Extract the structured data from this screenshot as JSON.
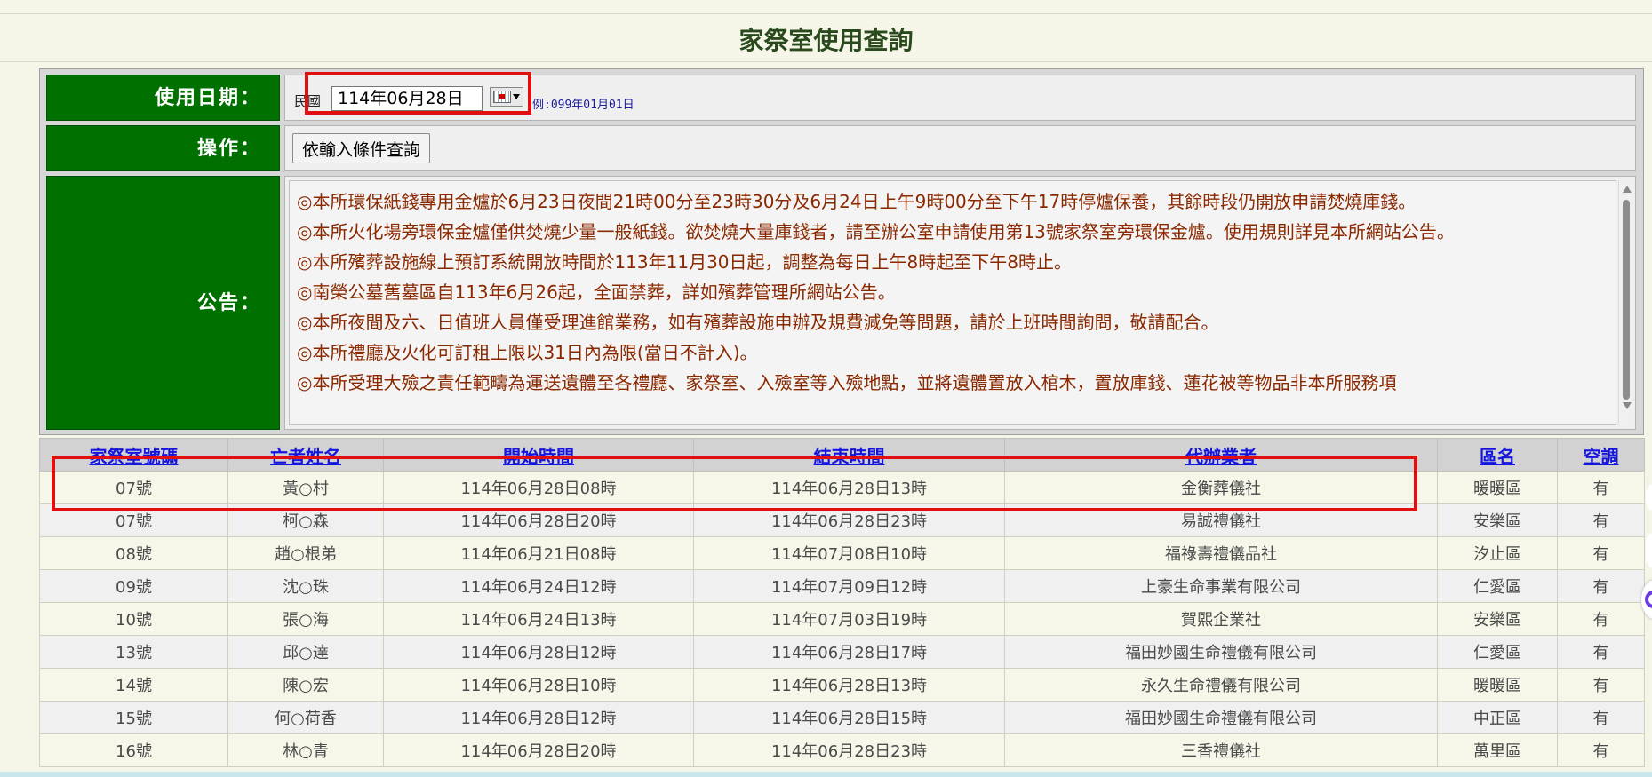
{
  "page": {
    "title": "家祭室使用查詢"
  },
  "form": {
    "date_label": "使用日期：",
    "minguo_prefix": "民國",
    "date_value": "114年06月28日",
    "date_hint": "例:099年01月01日",
    "operation_label": "操作：",
    "query_button": "依輸入條件查詢",
    "notice_label": "公告："
  },
  "notices": [
    "◎本所環保紙錢專用金爐於6月23日夜間21時00分至23時30分及6月24日上午9時00分至下午17時停爐保養，其餘時段仍開放申請焚燒庫錢。",
    "◎本所火化場旁環保金爐僅供焚燒少量一般紙錢。欲焚燒大量庫錢者，請至辦公室申請使用第13號家祭室旁環保金爐。使用規則詳見本所網站公告。",
    "◎本所殯葬設施線上預訂系統開放時間於113年11月30日起，調整為每日上午8時起至下午8時止。",
    "◎南榮公墓舊墓區自113年6月26起，全面禁葬，詳如殯葬管理所網站公告。",
    "◎本所夜間及六、日值班人員僅受理進館業務，如有殯葬設施申辦及規費減免等問題，請於上班時間詢問，敬請配合。",
    "◎本所禮廳及火化可訂租上限以31日內為限(當日不計入)。",
    "◎本所受理大殮之責任範疇為運送遺體至各禮廳、家祭室、入殮室等入殮地點，並將遺體置放入棺木，置放庫錢、蓮花被等物品非本所服務項"
  ],
  "table": {
    "headers": [
      "家祭室號碼",
      "亡者姓名",
      "開始時間",
      "結束時間",
      "代辦業者",
      "區名",
      "空調"
    ],
    "rows": [
      [
        "07號",
        "黃○村",
        "114年06月28日08時",
        "114年06月28日13時",
        "金衡葬儀社",
        "暖暖區",
        "有"
      ],
      [
        "07號",
        "柯○森",
        "114年06月28日20時",
        "114年06月28日23時",
        "易誠禮儀社",
        "安樂區",
        "有"
      ],
      [
        "08號",
        "趙○根弟",
        "114年06月21日08時",
        "114年07月08日10時",
        "福祿壽禮儀品社",
        "汐止區",
        "有"
      ],
      [
        "09號",
        "沈○珠",
        "114年06月24日12時",
        "114年07月09日12時",
        "上豪生命事業有限公司",
        "仁愛區",
        "有"
      ],
      [
        "10號",
        "張○海",
        "114年06月24日13時",
        "114年07月03日19時",
        "賀熙企業社",
        "安樂區",
        "有"
      ],
      [
        "13號",
        "邱○達",
        "114年06月28日12時",
        "114年06月28日17時",
        "福田妙國生命禮儀有限公司",
        "仁愛區",
        "有"
      ],
      [
        "14號",
        "陳○宏",
        "114年06月28日10時",
        "114年06月28日13時",
        "永久生命禮儀有限公司",
        "暖暖區",
        "有"
      ],
      [
        "15號",
        "何○荷香",
        "114年06月28日12時",
        "114年06月28日15時",
        "福田妙國生命禮儀有限公司",
        "中正區",
        "有"
      ],
      [
        "16號",
        "林○青",
        "114年06月28日20時",
        "114年06月28日23時",
        "三香禮儀社",
        "萬里區",
        "有"
      ]
    ]
  },
  "colors": {
    "label_bg": "#007000",
    "notice_text": "#8a2800",
    "header_link": "#1515e0",
    "highlight": "#e01010"
  }
}
